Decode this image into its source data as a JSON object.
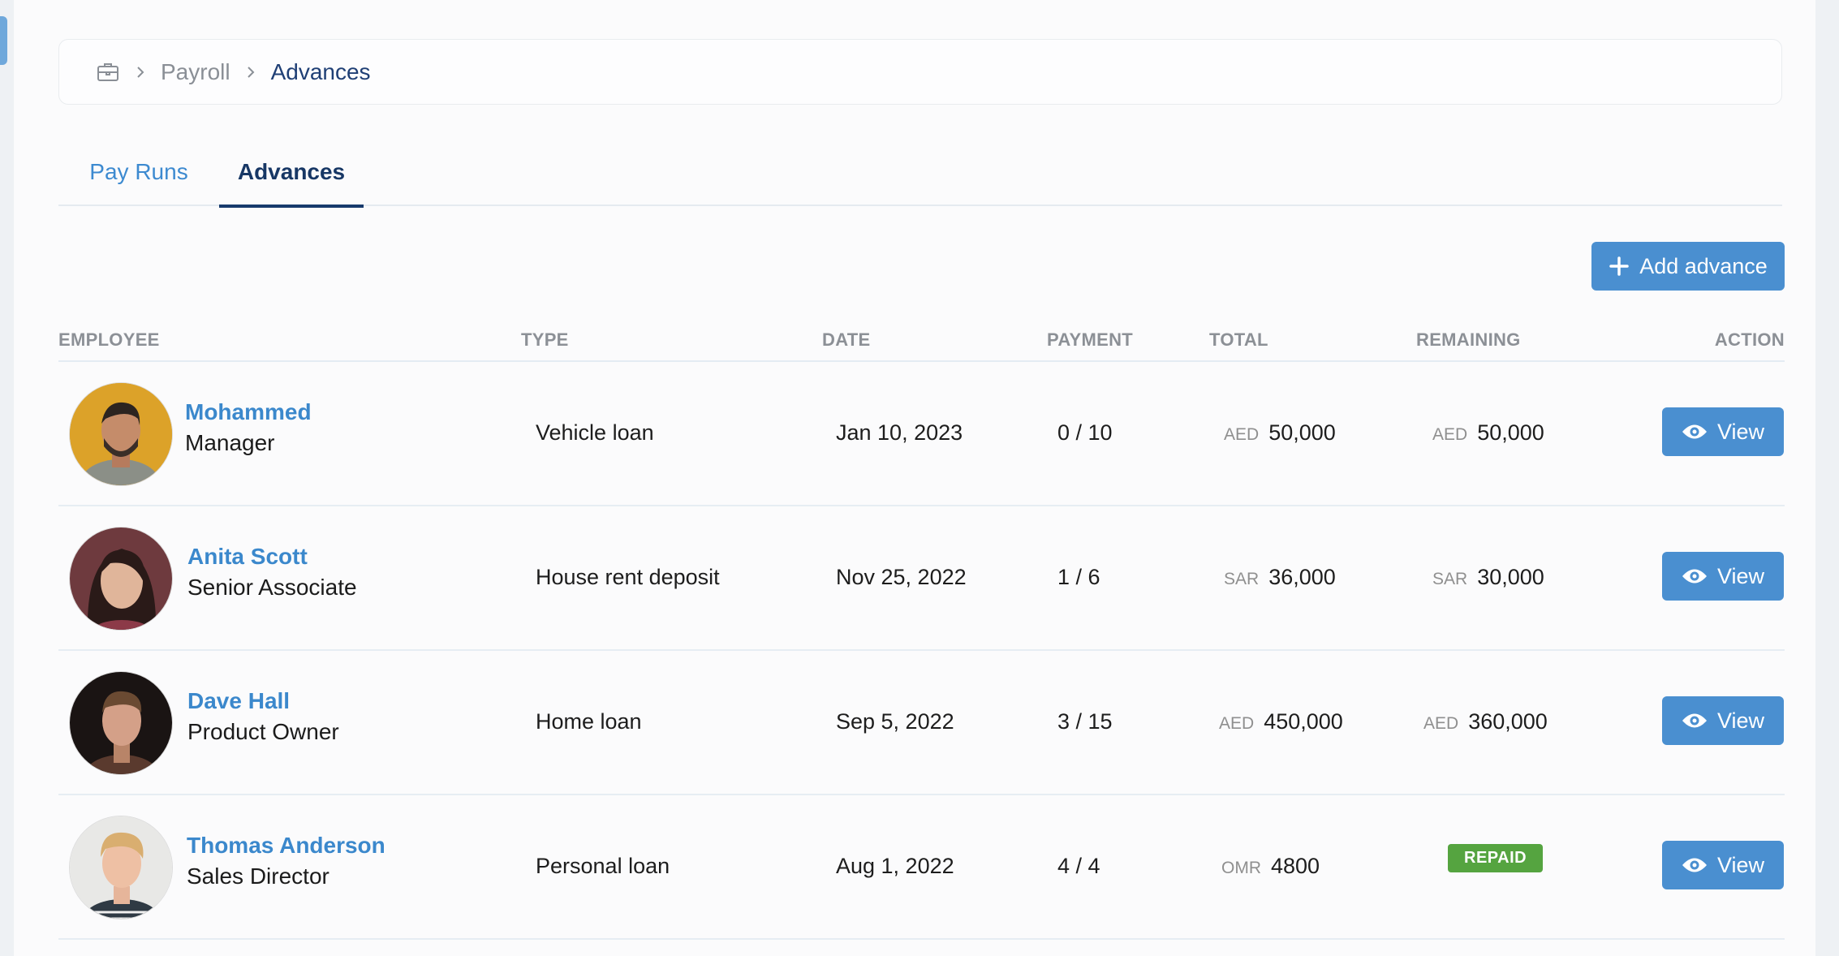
{
  "breadcrumb": {
    "icon": "briefcase-icon",
    "items": [
      "Payroll",
      "Advances"
    ]
  },
  "tabs": [
    {
      "label": "Pay Runs",
      "active": false
    },
    {
      "label": "Advances",
      "active": true
    }
  ],
  "toolbar": {
    "add_label": "Add advance"
  },
  "table": {
    "columns": [
      "EMPLOYEE",
      "TYPE",
      "DATE",
      "PAYMENT",
      "TOTAL",
      "REMAINING",
      "ACTION"
    ],
    "rows": [
      {
        "name": "Mohammed",
        "role": "Manager",
        "type": "Vehicle loan",
        "date": "Jan 10, 2023",
        "payment": "0 / 10",
        "total_currency": "AED",
        "total": "50,000",
        "remaining_currency": "AED",
        "remaining": "50,000",
        "action": "View"
      },
      {
        "name": "Anita Scott",
        "role": "Senior Associate",
        "type": "House rent deposit",
        "date": "Nov 25, 2022",
        "payment": "1 / 6",
        "total_currency": "SAR",
        "total": "36,000",
        "remaining_currency": "SAR",
        "remaining": "30,000",
        "action": "View"
      },
      {
        "name": "Dave Hall",
        "role": "Product Owner",
        "type": "Home loan",
        "date": "Sep 5, 2022",
        "payment": "3 / 15",
        "total_currency": "AED",
        "total": "450,000",
        "remaining_currency": "AED",
        "remaining": "360,000",
        "action": "View"
      },
      {
        "name": "Thomas Anderson",
        "role": "Sales Director",
        "type": "Personal loan",
        "date": "Aug 1, 2022",
        "payment": "4 / 4",
        "total_currency": "OMR",
        "total": "4800",
        "remaining_status": "REPAID",
        "action": "View"
      }
    ]
  },
  "colors": {
    "accent": "#4a8fd0",
    "link": "#3b88cc",
    "active_tab": "#173a6c",
    "repaid_badge": "#55a440"
  }
}
